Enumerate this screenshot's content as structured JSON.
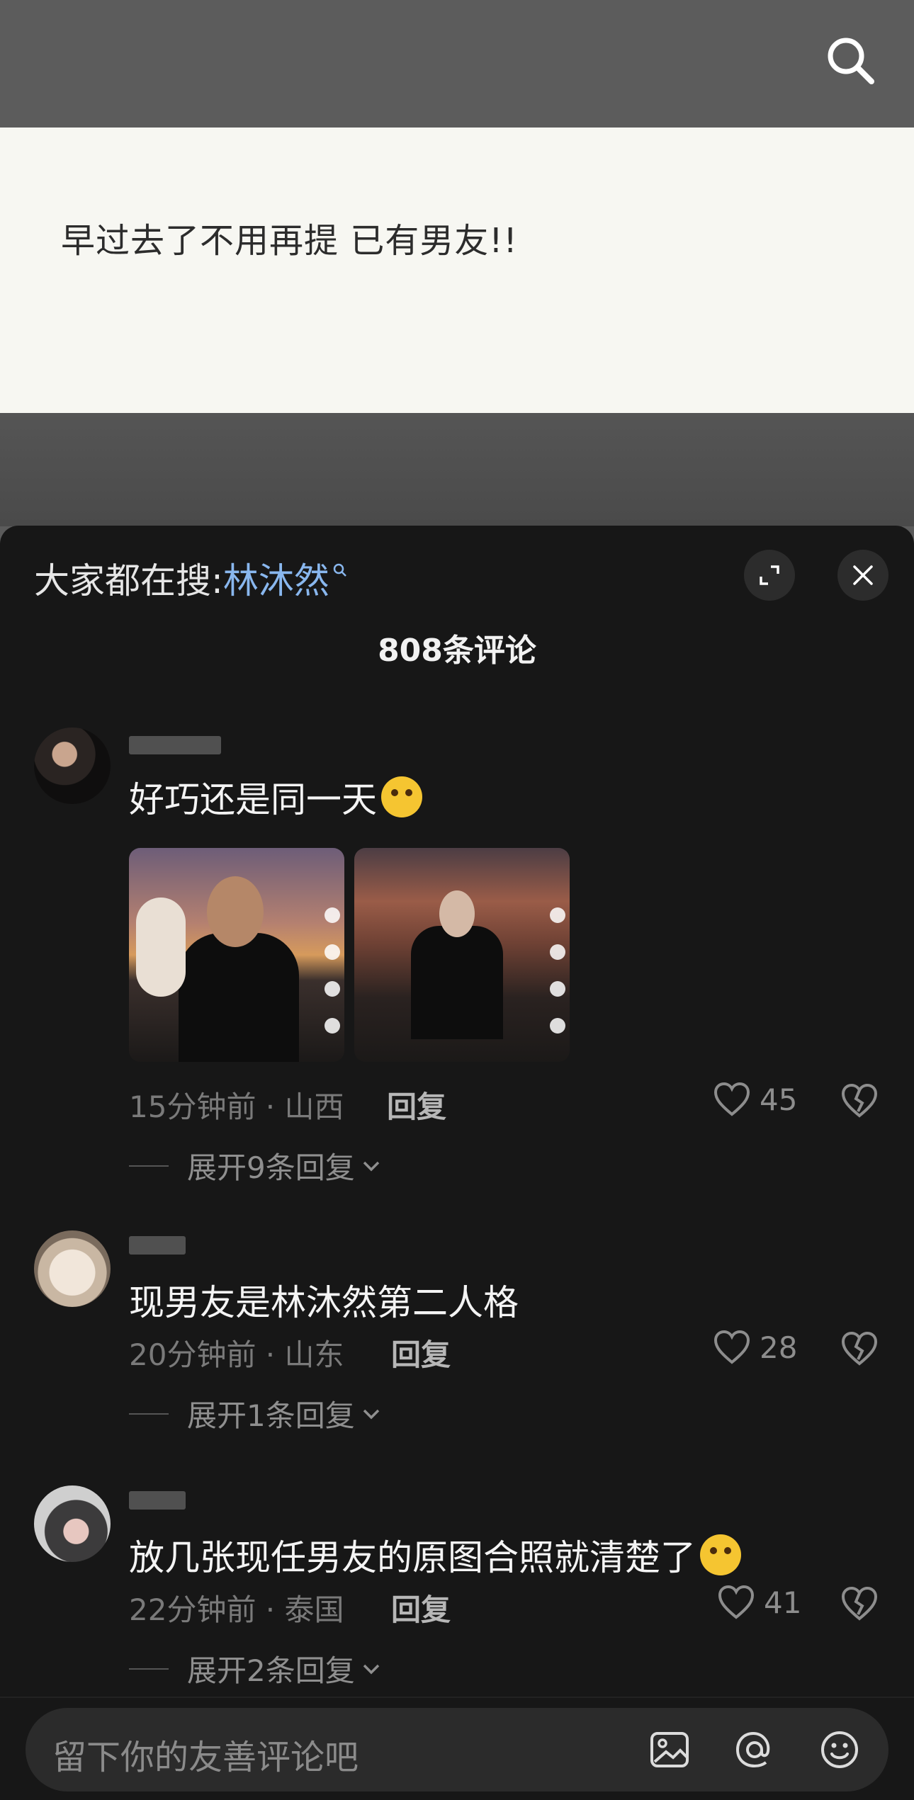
{
  "post": {
    "text": "早过去了不用再提 已有男友!!"
  },
  "sheet": {
    "hot_search_prefix": "大家都在搜:",
    "hot_search_term": "林沐然",
    "comment_count": "808条评论"
  },
  "comments": [
    {
      "text": "好巧还是同一天",
      "time": "15分钟前 · 山西",
      "reply_label": "回复",
      "likes": "45",
      "expand": "展开9条回复"
    },
    {
      "text": "现男友是林沐然第二人格",
      "time": "20分钟前 · 山东",
      "reply_label": "回复",
      "likes": "28",
      "expand": "展开1条回复"
    },
    {
      "text": "放几张现任男友的原图合照就清楚了",
      "time": "22分钟前 · 泰国",
      "reply_label": "回复",
      "likes": "41",
      "expand": "展开2条回复"
    }
  ],
  "composer": {
    "placeholder": "留下你的友善评论吧"
  },
  "icons": [
    "search-icon",
    "expand-icon",
    "close-icon",
    "heart-icon",
    "broken-heart-icon",
    "chevron-down-icon",
    "image-icon",
    "at-icon",
    "emoji-icon"
  ]
}
